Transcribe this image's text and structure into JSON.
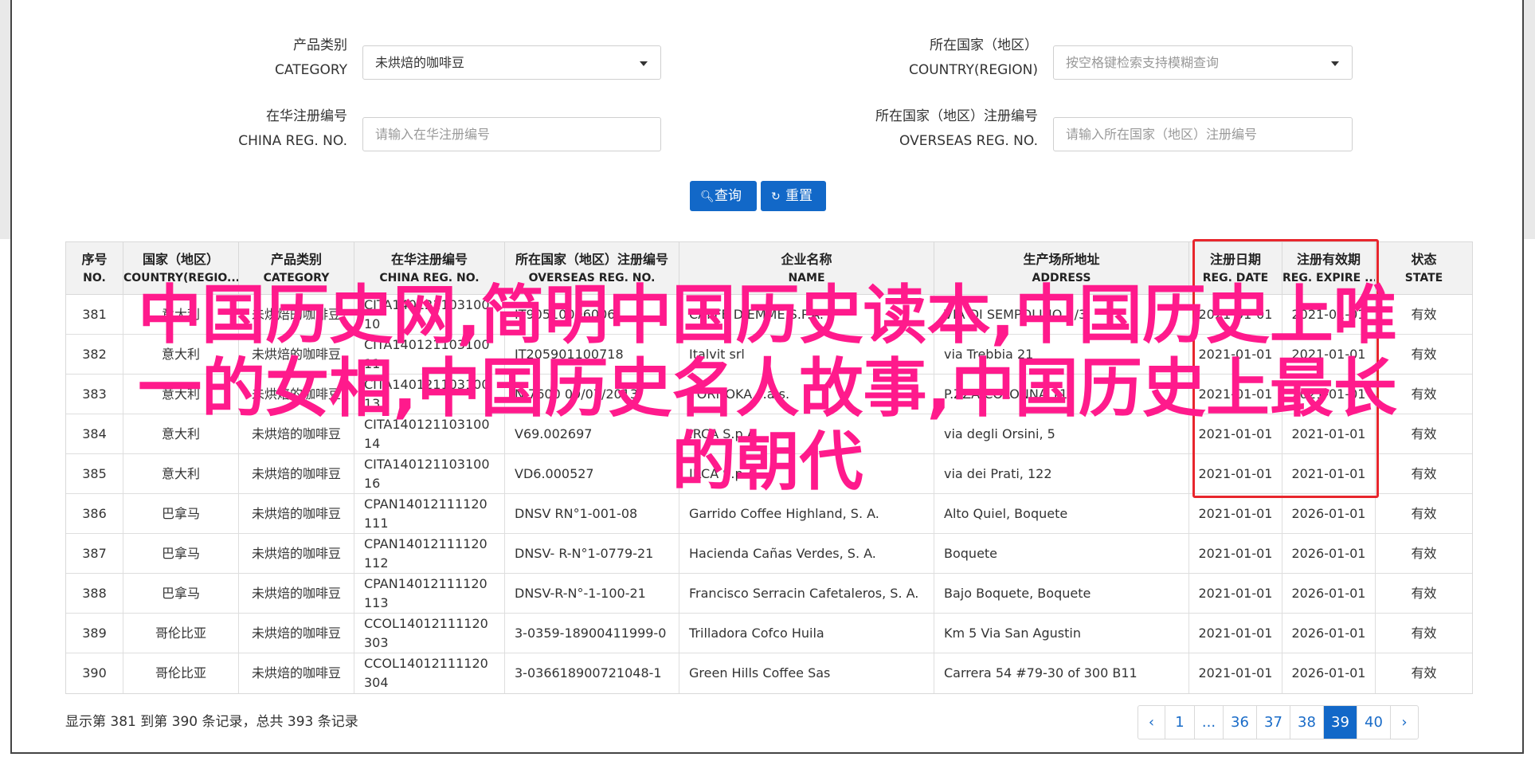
{
  "filters": {
    "category_label_cn": "产品类别",
    "category_label_en": "CATEGORY",
    "category_value": "未烘焙的咖啡豆",
    "country_label_cn": "所在国家（地区）",
    "country_label_en": "COUNTRY(REGION)",
    "country_placeholder": "按空格键检索支持模糊查询",
    "china_reg_label_cn": "在华注册编号",
    "china_reg_label_en": "CHINA REG. NO.",
    "china_reg_placeholder": "请输入在华注册编号",
    "overseas_reg_label_cn": "所在国家（地区）注册编号",
    "overseas_reg_label_en": "OVERSEAS REG. NO.",
    "overseas_reg_placeholder": "请输入所在国家（地区）注册编号",
    "search_label": "查询",
    "reset_label": "重置"
  },
  "table": {
    "columns": [
      {
        "cn": "序号",
        "en": "NO."
      },
      {
        "cn": "国家（地区）",
        "en": "COUNTRY(REGIO..."
      },
      {
        "cn": "产品类别",
        "en": "CATEGORY"
      },
      {
        "cn": "在华注册编号",
        "en": "CHINA REG. NO."
      },
      {
        "cn": "所在国家（地区）注册编号",
        "en": "OVERSEAS REG. NO."
      },
      {
        "cn": "企业名称",
        "en": "NAME"
      },
      {
        "cn": "生产场所地址",
        "en": "ADDRESS"
      },
      {
        "cn": "注册日期",
        "en": "REG. DATE"
      },
      {
        "cn": "注册有效期",
        "en": "REG. EXPIRE ..."
      },
      {
        "cn": "状态",
        "en": "STATE"
      }
    ],
    "rows": [
      {
        "no": "381",
        "country": "意大利",
        "category": "未烘焙的咖啡豆",
        "china_reg": "CITA14012110310010",
        "overseas_reg": "IT90510006006",
        "name": "CAFFE DIEMME S.P.A.",
        "address": "VIA DI SEMPOLINO 2/3",
        "reg_date": "2021-01-01",
        "expire": "2021-01-01",
        "state": "有效"
      },
      {
        "no": "382",
        "country": "意大利",
        "category": "未烘焙的咖啡豆",
        "china_reg": "CITA14012110310011",
        "overseas_reg": "IT205901100718",
        "name": "Italvit srl",
        "address": "via Trebbia 21",
        "reg_date": "2021-01-01",
        "expire": "2021-01-01",
        "state": "有效"
      },
      {
        "no": "383",
        "country": "意大利",
        "category": "未烘焙的咖啡豆",
        "china_reg": "CITA14012110310013",
        "overseas_reg": "N.7600 09/07/2013",
        "name": "TORNOKA s.a.s.",
        "address": "P.ZZA COLONNA 11",
        "reg_date": "2021-01-01",
        "expire": "2021-01-01",
        "state": "有效"
      },
      {
        "no": "384",
        "country": "意大利",
        "category": "未烘焙的咖啡豆",
        "china_reg": "CITA14012110310014",
        "overseas_reg": "V69.002697",
        "name": "IRCA S.p.A.",
        "address": "via degli Orsini, 5",
        "reg_date": "2021-01-01",
        "expire": "2021-01-01",
        "state": "有效"
      },
      {
        "no": "385",
        "country": "意大利",
        "category": "未烘焙的咖啡豆",
        "china_reg": "CITA14012110310016",
        "overseas_reg": "VD6.000527",
        "name": "IRCA S.p.A.",
        "address": "via dei Prati, 122",
        "reg_date": "2021-01-01",
        "expire": "2021-01-01",
        "state": "有效"
      },
      {
        "no": "386",
        "country": "巴拿马",
        "category": "未烘焙的咖啡豆",
        "china_reg": "CPAN14012111120111",
        "overseas_reg": "DNSV RN°1-001-08",
        "name": "Garrido Coffee Highland, S. A.",
        "address": "Alto Quiel, Boquete",
        "reg_date": "2021-01-01",
        "expire": "2026-01-01",
        "state": "有效"
      },
      {
        "no": "387",
        "country": "巴拿马",
        "category": "未烘焙的咖啡豆",
        "china_reg": "CPAN14012111120112",
        "overseas_reg": "DNSV- R-N°1-0779-21",
        "name": "Hacienda Cañas Verdes, S. A.",
        "address": "Boquete",
        "reg_date": "2021-01-01",
        "expire": "2026-01-01",
        "state": "有效"
      },
      {
        "no": "388",
        "country": "巴拿马",
        "category": "未烘焙的咖啡豆",
        "china_reg": "CPAN14012111120113",
        "overseas_reg": "DNSV-R-N°-1-100-21",
        "name": "Francisco Serracin Cafetaleros, S. A.",
        "address": "Bajo Boquete, Boquete",
        "reg_date": "2021-01-01",
        "expire": "2026-01-01",
        "state": "有效"
      },
      {
        "no": "389",
        "country": "哥伦比亚",
        "category": "未烘焙的咖啡豆",
        "china_reg": "CCOL14012111120303",
        "overseas_reg": "3-0359-18900411999-0",
        "name": "Trilladora Cofco Huila",
        "address": "Km 5 Via San Agustin",
        "reg_date": "2021-01-01",
        "expire": "2026-01-01",
        "state": "有效"
      },
      {
        "no": "390",
        "country": "哥伦比亚",
        "category": "未烘焙的咖啡豆",
        "china_reg": "CCOL14012111120304",
        "overseas_reg": "3-036618900721048-1",
        "name": "Green Hills Coffee Sas",
        "address": "Carrera 54 #79-30 of 300 B11",
        "reg_date": "2021-01-01",
        "expire": "2026-01-01",
        "state": "有效"
      }
    ]
  },
  "overlay": {
    "line1": "中国历史网,简明中国历史读本,中国历史上唯",
    "line2": "一的女相,中国历史名人故事,中国历史上最长",
    "line3": "的朝代"
  },
  "footer": {
    "summary": "显示第 381 到第 390 条记录，总共 393 条记录",
    "pages": [
      "‹",
      "1",
      "...",
      "36",
      "37",
      "38",
      "39",
      "40",
      "›"
    ],
    "active_page": "39"
  },
  "colors": {
    "primary": "#1268c8",
    "highlight_box": "#e8262d",
    "overlay_text": "#ff1a8c"
  }
}
